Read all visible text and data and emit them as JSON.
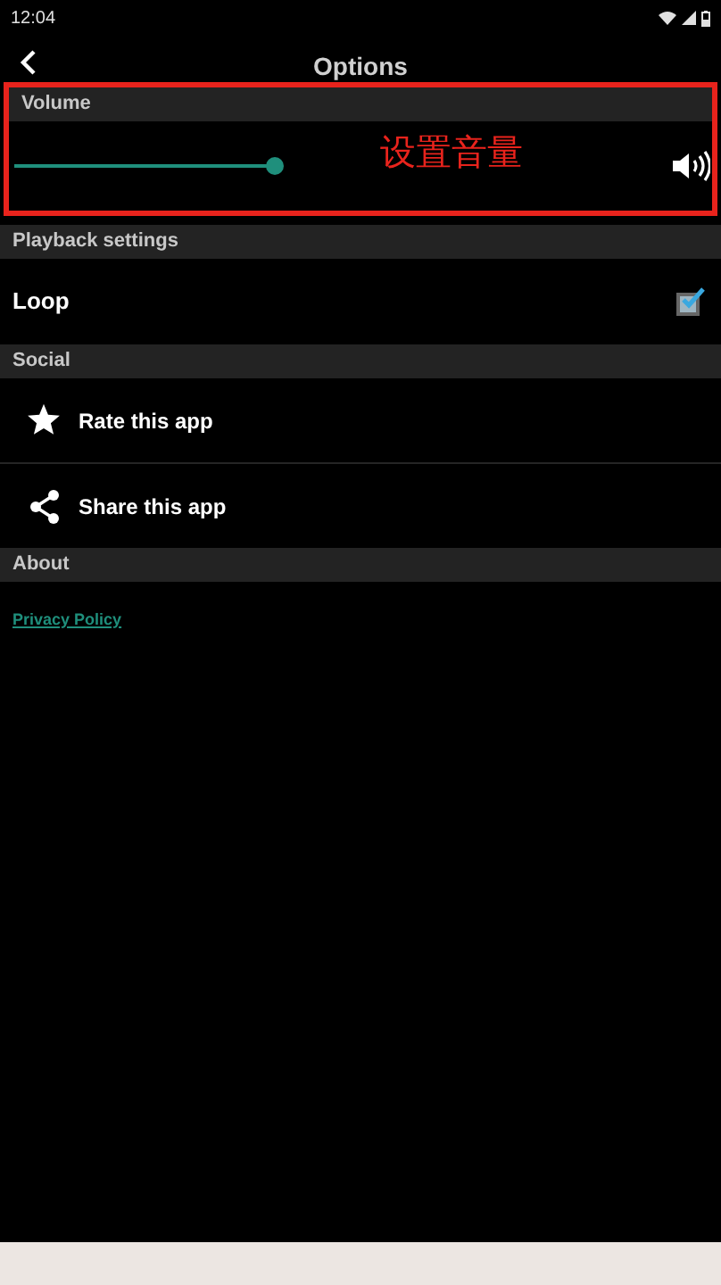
{
  "status_bar": {
    "time": "12:04"
  },
  "header": {
    "title": "Options"
  },
  "volume": {
    "heading": "Volume",
    "level": 0.41,
    "annotation": "设置音量"
  },
  "playback": {
    "heading": "Playback settings",
    "loop": {
      "label": "Loop",
      "checked": true
    }
  },
  "social": {
    "heading": "Social",
    "items": [
      {
        "label": "Rate this app",
        "kind": "star"
      },
      {
        "label": "Share this app",
        "kind": "share"
      }
    ]
  },
  "about": {
    "heading": "About",
    "link": "Privacy Policy"
  }
}
